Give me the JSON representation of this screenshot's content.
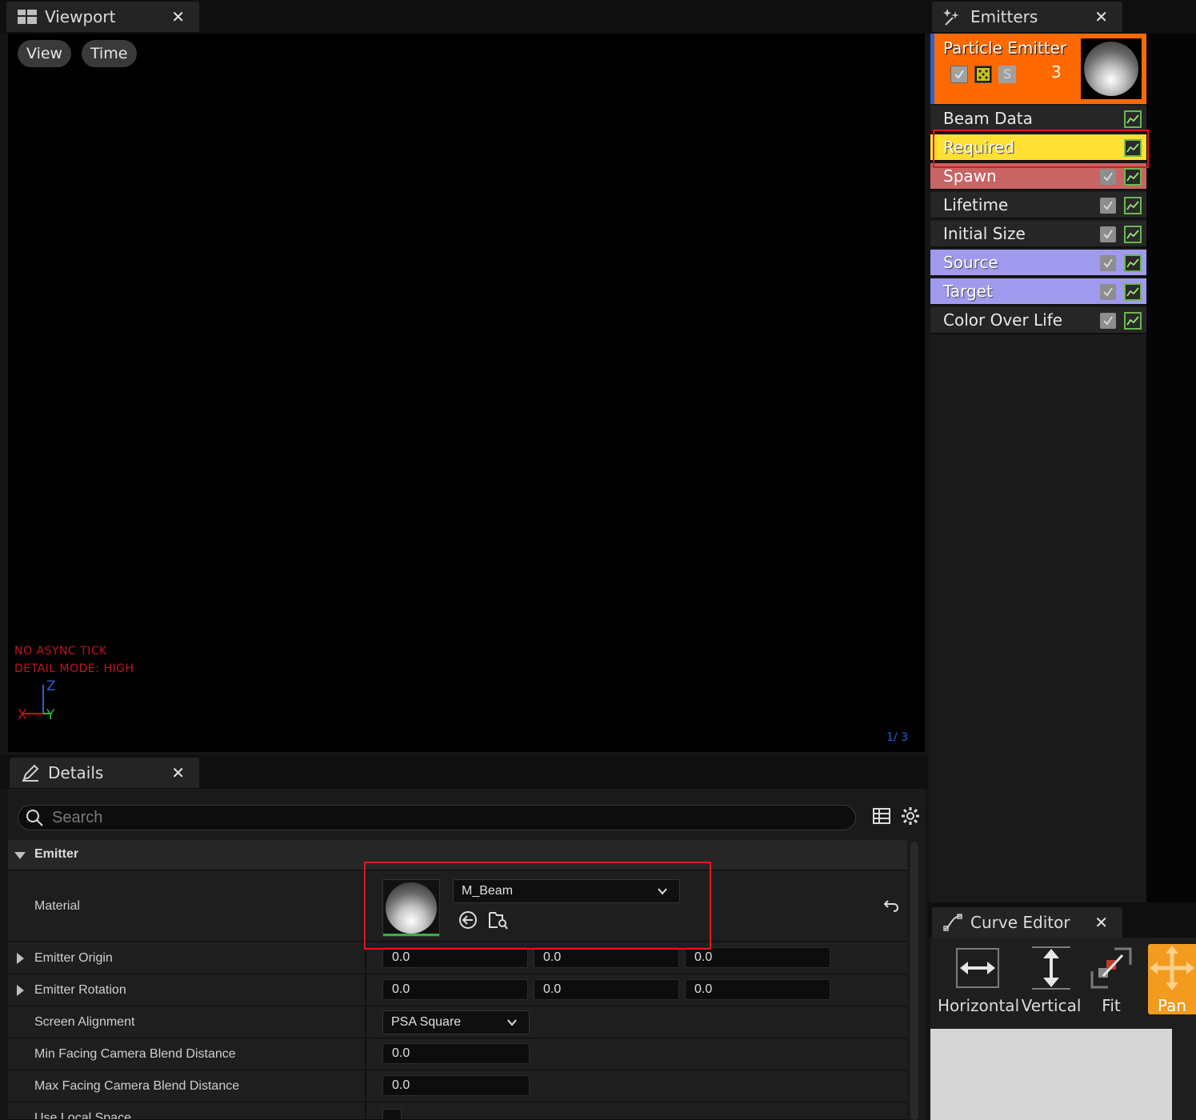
{
  "viewport": {
    "tab_title": "Viewport",
    "menu": {
      "view": "View",
      "time": "Time"
    },
    "stats": {
      "line1": "NO ASYNC TICK",
      "line2": "DETAIL MODE: HIGH"
    },
    "axes": {
      "z": "Z",
      "x": "X",
      "y": "Y"
    },
    "lod_counter": "1/ 3"
  },
  "emitters": {
    "tab_title": "Emitters",
    "emitter": {
      "name": "Particle Emitter",
      "count": "3",
      "solo_label": "S"
    },
    "modules": [
      {
        "label": "Beam Data"
      },
      {
        "label": "Required"
      },
      {
        "label": "Spawn"
      },
      {
        "label": "Lifetime"
      },
      {
        "label": "Initial Size"
      },
      {
        "label": "Source"
      },
      {
        "label": "Target"
      },
      {
        "label": "Color Over Life"
      }
    ],
    "colors": {
      "header": "#ff6a00",
      "required": "#ffe033",
      "spawn": "#c86464",
      "source_target": "#a09aee"
    }
  },
  "details": {
    "tab_title": "Details",
    "search": {
      "placeholder": "Search",
      "value": ""
    },
    "category": "Emitter",
    "material": {
      "label": "Material",
      "value": "M_Beam"
    },
    "emitter_origin": {
      "label": "Emitter Origin",
      "values": [
        "0.0",
        "0.0",
        "0.0"
      ]
    },
    "emitter_rotation": {
      "label": "Emitter Rotation",
      "values": [
        "0.0",
        "0.0",
        "0.0"
      ]
    },
    "screen_alignment": {
      "label": "Screen Alignment",
      "value": "PSA Square"
    },
    "min_facing": {
      "label": "Min Facing Camera Blend Distance",
      "value": "0.0"
    },
    "max_facing": {
      "label": "Max Facing Camera Blend Distance",
      "value": "0.0"
    },
    "use_local_space": {
      "label": "Use Local Space"
    }
  },
  "curve_editor": {
    "tab_title": "Curve Editor",
    "buttons": {
      "horizontal": "Horizontal",
      "vertical": "Vertical",
      "fit": "Fit",
      "pan": "Pan"
    }
  }
}
